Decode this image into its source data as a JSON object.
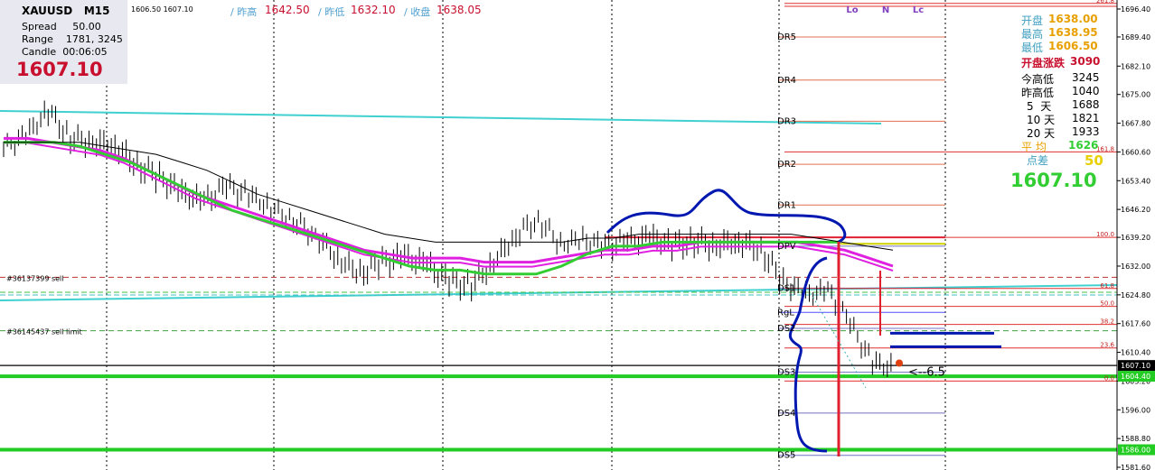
{
  "info_box": {
    "symbol": "XAUUSD",
    "timeframe": "M15",
    "spread_label": "Spread",
    "spread_value": "50.00",
    "range_label": "Range",
    "range_value": "1781, 3245",
    "candle_label": "Candle",
    "candle_value": "00:06:05",
    "price": "1607.10"
  },
  "header": {
    "bid_ask": "1606.50 1607.10",
    "prev_high_label": "/ 昨高",
    "prev_high_value": "1642.50",
    "prev_low_label": "/ 昨低",
    "prev_low_value": "1632.10",
    "close_label": "/ 收盘",
    "close_value": "1638.05"
  },
  "right_panel": {
    "open_label": "开盘",
    "open_value": "1638.00",
    "high_label": "最高",
    "high_value": "1638.95",
    "low_label": "最低",
    "low_value": "1606.50",
    "change_label": "开盘涨跌",
    "change_value": "3090",
    "today_range_label": "今高低",
    "today_range_value": "3245",
    "prev_range_label": "昨高低",
    "prev_range_value": "1040",
    "d5_label": "5  天",
    "d5_value": "1688",
    "d10_label": "10 天",
    "d10_value": "1821",
    "d20_label": "20 天",
    "d20_value": "1933",
    "avg_label": "平 均",
    "avg_value": "1626",
    "point_diff_label": "点差",
    "point_diff_value": "50",
    "current_price": "1607.10"
  },
  "colors": {
    "price_red": "#c8102e",
    "ma_magenta": "#e020e0",
    "ma_green": "#32cd32",
    "channel_cyan": "#40d0d0",
    "annotation_blue": "#0018b0",
    "level_red": "#e03030",
    "green_level": "#22cc22",
    "label_orange": "#e8a000",
    "label_cyan": "#40a0c0"
  },
  "chart_data": {
    "type": "line",
    "symbol": "XAUUSD",
    "timeframe": "M15",
    "y_ticks": [
      "1696.40",
      "1689.40",
      "1682.10",
      "1675.00",
      "1667.80",
      "1660.60",
      "1653.40",
      "1646.20",
      "1639.20",
      "1632.00",
      "1624.80",
      "1617.60",
      "1610.40",
      "1603.20",
      "1596.00",
      "1588.80",
      "1581.60"
    ],
    "ylim": [
      1580,
      1698
    ],
    "price_badges": [
      {
        "value": "1607.10",
        "color": "#000000"
      },
      {
        "value": "1604.40",
        "color": "#22cc22"
      },
      {
        "value": "1586.00",
        "color": "#22cc22"
      }
    ],
    "approx_close_path": [
      1662,
      1665,
      1671,
      1664,
      1663,
      1662,
      1657,
      1654,
      1650,
      1648,
      1652,
      1650,
      1647,
      1644,
      1640,
      1634,
      1630,
      1633,
      1634,
      1632,
      1628,
      1627,
      1633,
      1640,
      1644,
      1638,
      1639,
      1637,
      1638,
      1639,
      1637,
      1638,
      1637,
      1638,
      1636,
      1628,
      1625,
      1626,
      1618,
      1608,
      1606.5
    ],
    "moving_averages": [
      {
        "color": "magenta",
        "values": [
          1664,
          1664,
          1663,
          1662,
          1661,
          1659,
          1656,
          1653,
          1650,
          1648,
          1646,
          1644,
          1642,
          1640,
          1638,
          1636,
          1635,
          1634,
          1634,
          1634,
          1633,
          1633,
          1633,
          1634,
          1635,
          1636,
          1636,
          1637,
          1637,
          1638,
          1638,
          1638,
          1638,
          1638,
          1637,
          1636,
          1634,
          1632
        ]
      },
      {
        "color": "green",
        "values": [
          1663,
          1663,
          1663,
          1662,
          1660,
          1658,
          1655,
          1652,
          1649,
          1646,
          1644,
          1642,
          1640,
          1638,
          1636,
          1634,
          1632,
          1631,
          1631,
          1630,
          1630,
          1630,
          1632,
          1635,
          1637,
          1637,
          1638,
          1638,
          1638,
          1638,
          1638,
          1638,
          1638,
          1638
        ]
      },
      {
        "color": "black",
        "values": [
          1663,
          1663,
          1663,
          1663,
          1662,
          1661,
          1660,
          1658,
          1656,
          1653,
          1650,
          1648,
          1646,
          1644,
          1642,
          1640,
          1639,
          1638,
          1638,
          1638,
          1638,
          1638,
          1638,
          1639,
          1639,
          1640,
          1640,
          1640,
          1640,
          1640,
          1640,
          1640,
          1639,
          1638,
          1637,
          1636
        ]
      }
    ],
    "pivot_levels": [
      {
        "name": "DR5",
        "value": 1689.4
      },
      {
        "name": "DR4",
        "value": 1678.6
      },
      {
        "name": "DR3",
        "value": 1668.3
      },
      {
        "name": "DR2",
        "value": 1657.5
      },
      {
        "name": "DR1",
        "value": 1647.3
      },
      {
        "name": "DPV",
        "value": 1637.0
      },
      {
        "name": "DS1",
        "value": 1626.5
      },
      {
        "name": "RgL",
        "value": 1620.4
      },
      {
        "name": "DS2",
        "value": 1616.4
      },
      {
        "name": "DS3",
        "value": 1605.4
      },
      {
        "name": "DS4",
        "value": 1595.2
      },
      {
        "name": "DS5",
        "value": 1584.6
      }
    ],
    "fib_levels": [
      {
        "label": "100.0",
        "value": 1639.2
      },
      {
        "label": "61.8",
        "value": 1626.4
      },
      {
        "label": "50.0",
        "value": 1621.9
      },
      {
        "label": "38.2",
        "value": 1617.4
      },
      {
        "label": "23.6",
        "value": 1611.5
      },
      {
        "label": "0.0",
        "value": 1603.2
      },
      {
        "label": "161.8",
        "value": 1660.6
      },
      {
        "label": "261.8",
        "value": 1697.8
      }
    ],
    "order_lines": [
      {
        "label": "#36137399 sell",
        "value": 1629.2
      },
      {
        "label": "#36145437 sell limit",
        "value": 1615.8
      }
    ],
    "top_markers": [
      "Lo",
      "N",
      "Lc"
    ],
    "annotation": "<--6.5"
  }
}
